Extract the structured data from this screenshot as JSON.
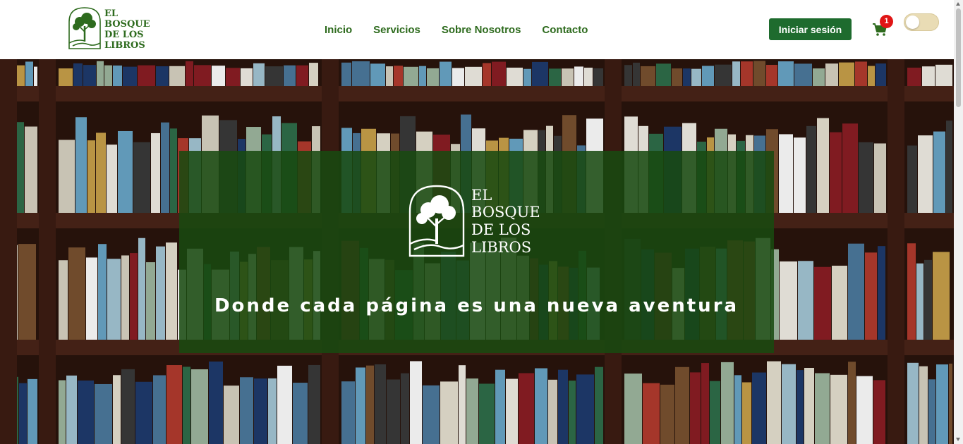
{
  "brand": {
    "name_lines": [
      "EL",
      "BOSQUE",
      "DE LOS",
      "LIBROS"
    ],
    "logo_icon": "tree-arch-icon",
    "color": "#2e6b1e"
  },
  "nav": {
    "links": [
      {
        "label": "Inicio"
      },
      {
        "label": "Servicios"
      },
      {
        "label": "Sobre Nosotros"
      },
      {
        "label": "Contacto"
      }
    ]
  },
  "header": {
    "login_label": "Iniciar sesión",
    "login_color": "#1e6b2e",
    "cart_icon": "shopping-cart-icon",
    "cart_count": "1",
    "theme_toggle": "off"
  },
  "hero": {
    "background": "bookshelf-photo",
    "overlay_color": "#184a10",
    "tagline": "Donde cada página es una nueva aventura"
  }
}
